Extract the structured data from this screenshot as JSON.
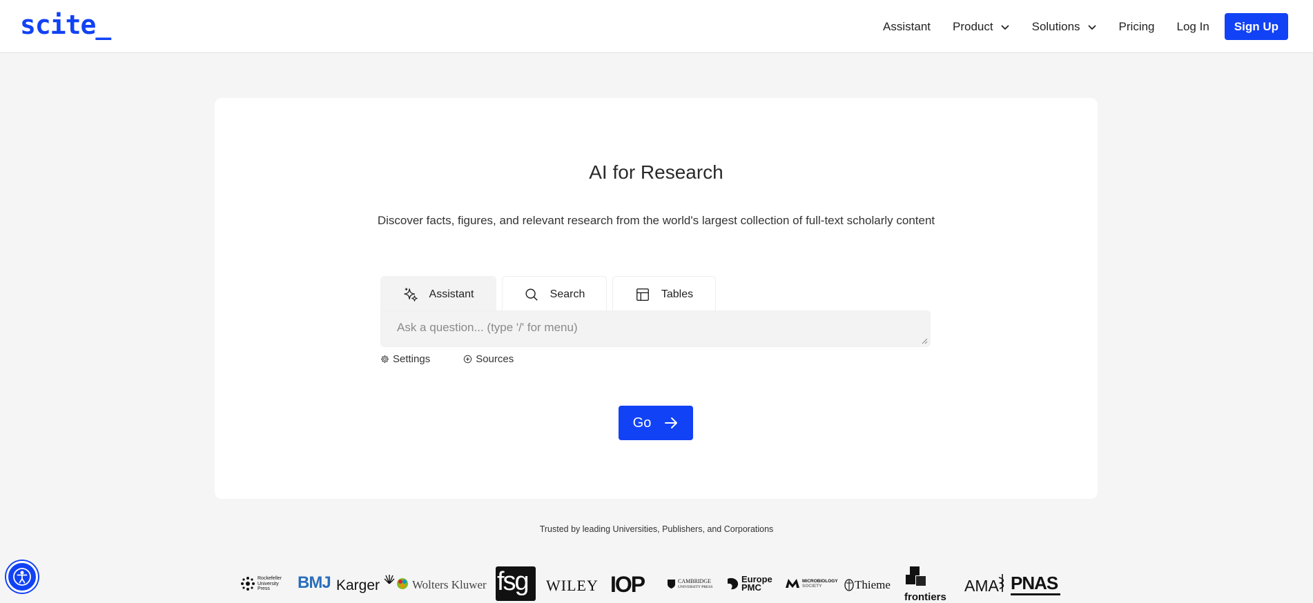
{
  "brand": {
    "logo_text": "scite_",
    "accent": "#1142f5"
  },
  "nav": {
    "assistant": "Assistant",
    "product": "Product",
    "solutions": "Solutions",
    "pricing": "Pricing",
    "login": "Log In",
    "signup": "Sign Up"
  },
  "hero": {
    "title": "AI for Research",
    "subtitle": "Discover facts, figures, and relevant research from the world's largest collection of full-text scholarly content"
  },
  "tabs": [
    {
      "label": "Assistant",
      "icon": "sparkles-icon",
      "active": true
    },
    {
      "label": "Search",
      "icon": "search-icon",
      "active": false
    },
    {
      "label": "Tables",
      "icon": "table-icon",
      "active": false
    }
  ],
  "query": {
    "placeholder": "Ask a question... (type '/' for menu)",
    "value": ""
  },
  "options": {
    "settings": "Settings",
    "sources": "Sources"
  },
  "go_button": {
    "label": "Go"
  },
  "trusted": {
    "text": "Trusted by leading Universities, Publishers, and Corporations",
    "logos": {
      "rockefeller": [
        "Rockefeller",
        "University",
        "Press"
      ],
      "bmj": "BMJ",
      "karger": "Karger",
      "wolters": "Wolters Kluwer",
      "fsg": "fsg",
      "wiley": "WILEY",
      "iop": "IOP",
      "cambridge": [
        "CAMBRIDGE",
        "UNIVERSITY PRESS"
      ],
      "europepmc": [
        "Europe",
        "PMC"
      ],
      "microbiology": [
        "MICROBIOLOGY",
        "SOCIETY"
      ],
      "thieme": "Thieme",
      "frontiers": "frontiers",
      "ama": "AMA",
      "pnas": "PNAS"
    }
  }
}
